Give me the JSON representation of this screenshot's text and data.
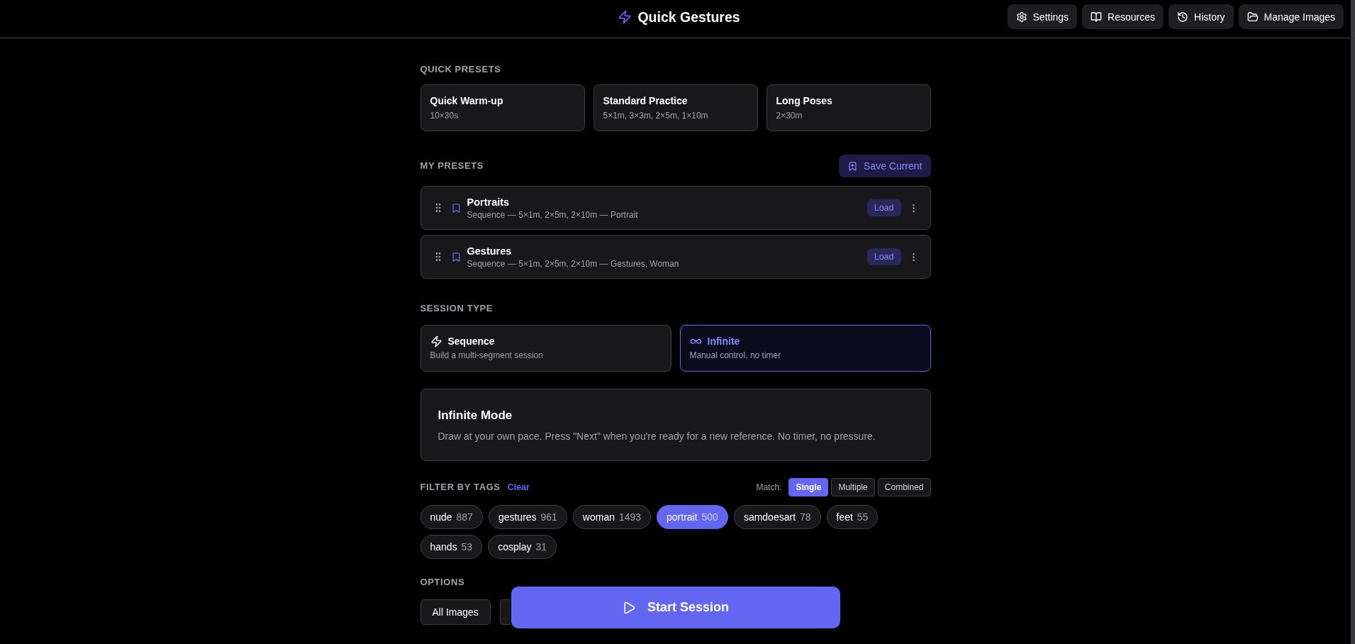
{
  "header": {
    "title": "Quick Gestures",
    "buttons": [
      {
        "label": "Settings"
      },
      {
        "label": "Resources"
      },
      {
        "label": "History"
      },
      {
        "label": "Manage Images"
      }
    ]
  },
  "quick_presets": {
    "heading": "QUICK PRESETS",
    "items": [
      {
        "title": "Quick Warm-up",
        "detail": "10×30s"
      },
      {
        "title": "Standard Practice",
        "detail": "5×1m, 3×3m, 2×5m, 1×10m"
      },
      {
        "title": "Long Poses",
        "detail": "2×30m"
      }
    ]
  },
  "my_presets": {
    "heading": "MY PRESETS",
    "save_button": "Save Current",
    "items": [
      {
        "name": "Portraits",
        "detail": "Sequence — 5×1m, 2×5m, 2×10m — Portrait",
        "load_button": "Load"
      },
      {
        "name": "Gestures",
        "detail": "Sequence — 5×1m, 2×5m, 2×10m — Gestures, Woman",
        "load_button": "Load"
      }
    ]
  },
  "session_type": {
    "heading": "SESSION TYPE",
    "options": [
      {
        "title": "Sequence",
        "description": "Build a multi-segment session",
        "selected": false
      },
      {
        "title": "Infinite",
        "description": "Manual control, no timer",
        "selected": true
      }
    ]
  },
  "mode_info": {
    "title": "Infinite Mode",
    "text": "Draw at your own pace. Press \"Next\" when you're ready for a new reference. No timer, no pressure."
  },
  "tag_filter": {
    "heading": "FILTER BY TAGS",
    "clear_link": "Clear",
    "match_label": "Match:",
    "match_options": [
      {
        "label": "Single",
        "selected": true
      },
      {
        "label": "Multiple",
        "selected": false
      },
      {
        "label": "Combined",
        "selected": false
      }
    ],
    "tags": [
      {
        "name": "nude",
        "count": "887",
        "selected": false
      },
      {
        "name": "gestures",
        "count": "961",
        "selected": false
      },
      {
        "name": "woman",
        "count": "1493",
        "selected": false
      },
      {
        "name": "portrait",
        "count": "500",
        "selected": true
      },
      {
        "name": "samdoesart",
        "count": "78",
        "selected": false
      },
      {
        "name": "feet",
        "count": "55",
        "selected": false
      },
      {
        "name": "hands",
        "count": "53",
        "selected": false
      },
      {
        "name": "cosplay",
        "count": "31",
        "selected": false
      }
    ]
  },
  "options": {
    "heading": "OPTIONS",
    "buttons": [
      {
        "kind": "button",
        "label": "All Images"
      },
      {
        "kind": "covered"
      }
    ]
  },
  "start_button": {
    "label": "Start Session"
  }
}
